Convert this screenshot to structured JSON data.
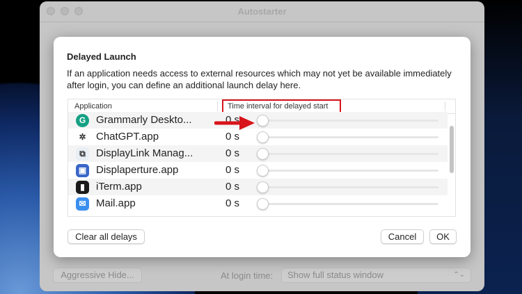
{
  "window": {
    "title": "Autostarter"
  },
  "background_window": {
    "aggressive_hide_label": "Aggressive Hide...",
    "login_time_label": "At login time:",
    "login_time_value": "Show full status window"
  },
  "sheet": {
    "title": "Delayed Launch",
    "description": "If an application needs access to external resources which may not yet be available immediately after login, you can define an additional launch delay here.",
    "columns": {
      "application": "Application",
      "interval": "Time interval for delayed start"
    },
    "rows": [
      {
        "name": "Grammarly Deskto...",
        "value": "0 s",
        "delay": 0,
        "icon": "grammarly-icon",
        "color": "#15a083",
        "glyph": "G"
      },
      {
        "name": "ChatGPT.app",
        "value": "0 s",
        "delay": 0,
        "icon": "chatgpt-icon",
        "color": "#ffffff",
        "glyph": "✲"
      },
      {
        "name": "DisplayLink Manag...",
        "value": "0 s",
        "delay": 0,
        "icon": "displaylink-icon",
        "color": "#e8eef4",
        "glyph": "⧉"
      },
      {
        "name": "Displaperture.app",
        "value": "0 s",
        "delay": 0,
        "icon": "displaperture-icon",
        "color": "#3a66c8",
        "glyph": "▣"
      },
      {
        "name": "iTerm.app",
        "value": "0 s",
        "delay": 0,
        "icon": "iterm-icon",
        "color": "#1a1a1a",
        "glyph": "▮"
      },
      {
        "name": "Mail.app",
        "value": "0 s",
        "delay": 0,
        "icon": "mail-icon",
        "color": "#3b8ff0",
        "glyph": "✉"
      }
    ],
    "clear_label": "Clear all delays",
    "cancel_label": "Cancel",
    "ok_label": "OK"
  },
  "colors": {
    "highlight": "#d8141b"
  }
}
